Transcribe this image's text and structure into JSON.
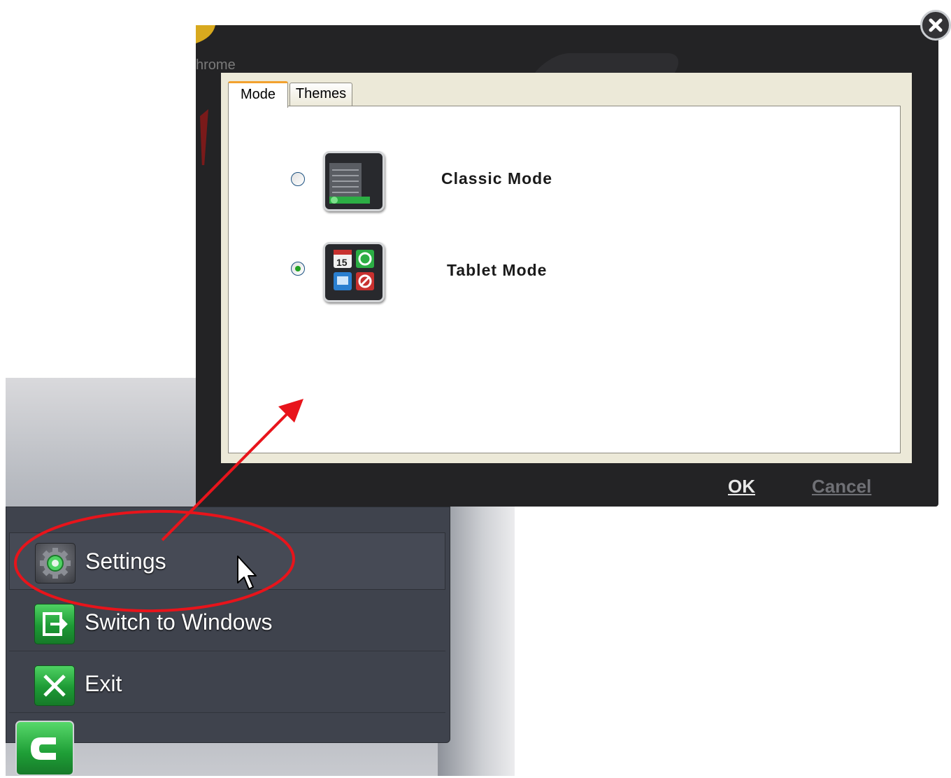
{
  "dialog": {
    "background_label_fragment": "hrome",
    "tabs": [
      {
        "label": "Mode",
        "selected": true
      },
      {
        "label": "Themes",
        "selected": false
      }
    ],
    "options": [
      {
        "label": "Classic Mode",
        "icon": "classic-mode-icon",
        "selected": false
      },
      {
        "label": "Tablet Mode",
        "icon": "tablet-mode-icon",
        "selected": true
      }
    ],
    "ok_label": "OK",
    "cancel_label": "Cancel",
    "tablet_icon_calendar_text": "15"
  },
  "menu": {
    "items": [
      {
        "label": "Settings",
        "icon": "gear-icon"
      },
      {
        "label": "Switch to Windows",
        "icon": "switch-windows-icon"
      },
      {
        "label": "Exit",
        "icon": "exit-icon"
      }
    ]
  },
  "colors": {
    "annotation_red": "#e8141b",
    "tab_accent": "#f2a12e",
    "menu_panel": "#3f434d",
    "brand_green": "#1e9e36"
  }
}
